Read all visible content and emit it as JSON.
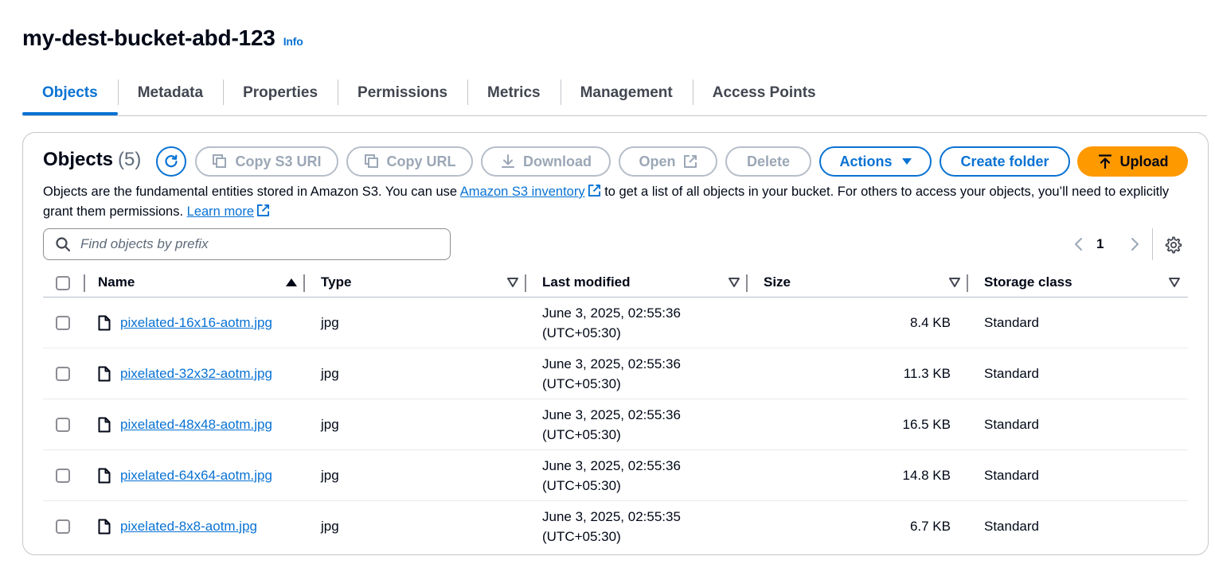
{
  "header": {
    "title": "my-dest-bucket-abd-123",
    "info": "Info"
  },
  "tabs": [
    "Objects",
    "Metadata",
    "Properties",
    "Permissions",
    "Metrics",
    "Management",
    "Access Points"
  ],
  "panel": {
    "title": "Objects",
    "count": "(5)",
    "buttons": {
      "copy_s3_uri": "Copy S3 URI",
      "copy_url": "Copy URL",
      "download": "Download",
      "open": "Open",
      "delete": "Delete",
      "actions": "Actions",
      "create_folder": "Create folder",
      "upload": "Upload"
    },
    "description": {
      "part1": "Objects are the fundamental entities stored in Amazon S3. You can use ",
      "link1": "Amazon S3 inventory",
      "part2": " to get a list of all objects in your bucket. For others to access your objects, you’ll need to explicitly grant them permissions. ",
      "link2": "Learn more"
    },
    "search": {
      "placeholder": "Find objects by prefix",
      "value": ""
    },
    "pagination": {
      "page": "1"
    }
  },
  "table": {
    "columns": [
      "Name",
      "Type",
      "Last modified",
      "Size",
      "Storage class"
    ],
    "rows": [
      {
        "name": "pixelated-16x16-aotm.jpg",
        "type": "jpg",
        "date": "June 3, 2025, 02:55:36",
        "tz": "(UTC+05:30)",
        "size": "8.4 KB",
        "storage": "Standard"
      },
      {
        "name": "pixelated-32x32-aotm.jpg",
        "type": "jpg",
        "date": "June 3, 2025, 02:55:36",
        "tz": "(UTC+05:30)",
        "size": "11.3 KB",
        "storage": "Standard"
      },
      {
        "name": "pixelated-48x48-aotm.jpg",
        "type": "jpg",
        "date": "June 3, 2025, 02:55:36",
        "tz": "(UTC+05:30)",
        "size": "16.5 KB",
        "storage": "Standard"
      },
      {
        "name": "pixelated-64x64-aotm.jpg",
        "type": "jpg",
        "date": "June 3, 2025, 02:55:36",
        "tz": "(UTC+05:30)",
        "size": "14.8 KB",
        "storage": "Standard"
      },
      {
        "name": "pixelated-8x8-aotm.jpg",
        "type": "jpg",
        "date": "June 3, 2025, 02:55:35",
        "tz": "(UTC+05:30)",
        "size": "6.7 KB",
        "storage": "Standard"
      }
    ]
  },
  "colors": {
    "link": "#0972d3",
    "upload": "#ff9900",
    "disabled": "#9ba7b6",
    "text": "#000716"
  }
}
